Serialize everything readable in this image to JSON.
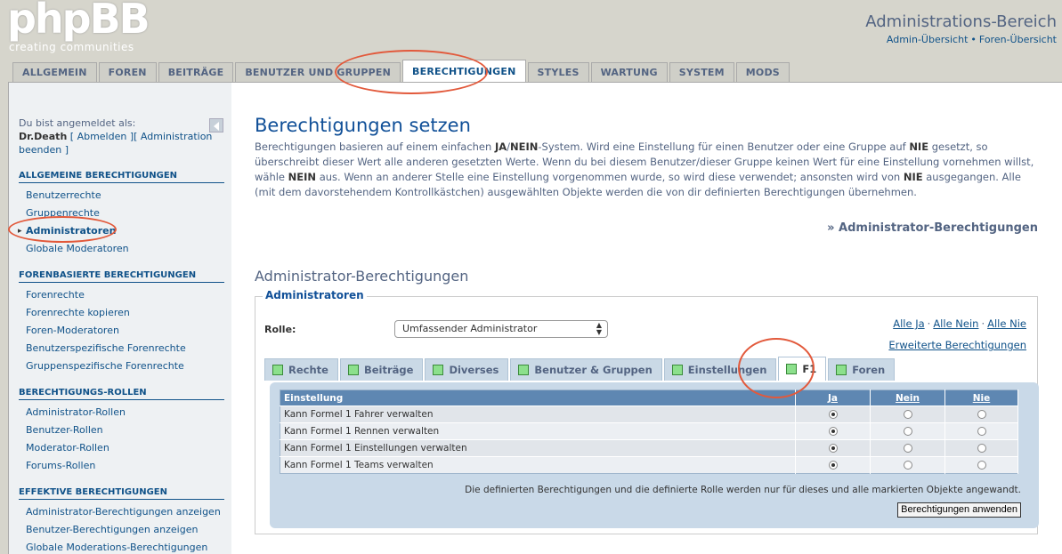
{
  "header": {
    "logo": "phpBB",
    "logo_reg": "®",
    "logo_sub": "creating   communities",
    "title": "Administrations-Bereich",
    "link_overview": "Admin-Übersicht",
    "link_sep": "•",
    "link_forum": "Foren-Übersicht"
  },
  "tabs": [
    {
      "label": "Allgemein"
    },
    {
      "label": "Foren"
    },
    {
      "label": "Beiträge"
    },
    {
      "label": "Benutzer und Gruppen"
    },
    {
      "label": "Berechtigungen"
    },
    {
      "label": "Styles"
    },
    {
      "label": "Wartung"
    },
    {
      "label": "System"
    },
    {
      "label": "Mods"
    }
  ],
  "menu": {
    "login_prefix": "Du bist angemeldet als:",
    "user": "Dr.Death",
    "logout": "[ Abmelden ][ Administration beenden ]",
    "sections": [
      {
        "title": "Allgemeine Berechtigungen",
        "items": [
          "Benutzerrechte",
          "Gruppenrechte",
          "Administratoren",
          "Globale Moderatoren"
        ]
      },
      {
        "title": "Forenbasierte Berechtigungen",
        "items": [
          "Forenrechte",
          "Forenrechte kopieren",
          "Foren-Moderatoren",
          "Benutzerspezifische Forenrechte",
          "Gruppenspezifische Forenrechte"
        ]
      },
      {
        "title": "Berechtigungs-Rollen",
        "items": [
          "Administrator-Rollen",
          "Benutzer-Rollen",
          "Moderator-Rollen",
          "Forums-Rollen"
        ]
      },
      {
        "title": "Effektive Berechtigungen",
        "items": [
          "Administrator-Berechtigungen anzeigen",
          "Benutzer-Berechtigungen anzeigen",
          "Globale Moderations-Berechtigungen"
        ]
      }
    ]
  },
  "main": {
    "title": "Berechtigungen setzen",
    "intro_1": "Berechtigungen basieren auf einem einfachen ",
    "intro_b1": "JA",
    "intro_2": "/",
    "intro_b2": "NEIN",
    "intro_3": "-System. Wird eine Einstellung für einen Benutzer oder eine Gruppe auf ",
    "intro_b3": "NIE",
    "intro_4": " gesetzt, so überschreibt dieser Wert alle anderen gesetzten Werte. Wenn du bei diesem Benutzer/dieser Gruppe keinen Wert für eine Einstellung vornehmen willst, wähle ",
    "intro_b4": "NEIN",
    "intro_5": " aus. Wenn an anderer Stelle eine Einstellung vorgenommen wurde, so wird diese verwendet; ansonsten wird von ",
    "intro_b5": "NIE",
    "intro_6": " ausgegangen. Alle (mit dem davorstehendem Kontrollkästchen) ausgewählten Objekte werden die von dir definierten Berechtigungen übernehmen.",
    "right_link": "» Administrator-Berechtigungen",
    "subtitle": "Administrator-Berechtigungen",
    "legend": "Administratoren",
    "role_label": "Rolle:",
    "role_value": "Umfassender Administrator",
    "all_yes": "Alle Ja",
    "all_no": "Alle Nein",
    "all_never": "Alle Nie",
    "dot": "·",
    "advanced": "Erweiterte Berechtigungen",
    "ptabs": [
      "Rechte",
      "Beiträge",
      "Diverses",
      "Benutzer & Gruppen",
      "Einstellungen",
      "F1",
      "Foren"
    ],
    "table": {
      "col_setting": "Einstellung",
      "col_yes": "Ja",
      "col_no": "Nein",
      "col_never": "Nie",
      "rows": [
        {
          "label": "Kann Formel 1 Fahrer verwalten",
          "value": "yes"
        },
        {
          "label": "Kann Formel 1 Rennen verwalten",
          "value": "yes"
        },
        {
          "label": "Kann Formel 1 Einstellungen verwalten",
          "value": "yes"
        },
        {
          "label": "Kann Formel 1 Teams verwalten",
          "value": "yes"
        }
      ]
    },
    "note": "Die definierten Berechtigungen und die definierte Rolle werden nur für dieses und alle markierten Objekte angewandt.",
    "apply": "Berechtigungen anwenden"
  },
  "colors": {
    "annotation": "#e2593b",
    "accent": "#105289"
  }
}
